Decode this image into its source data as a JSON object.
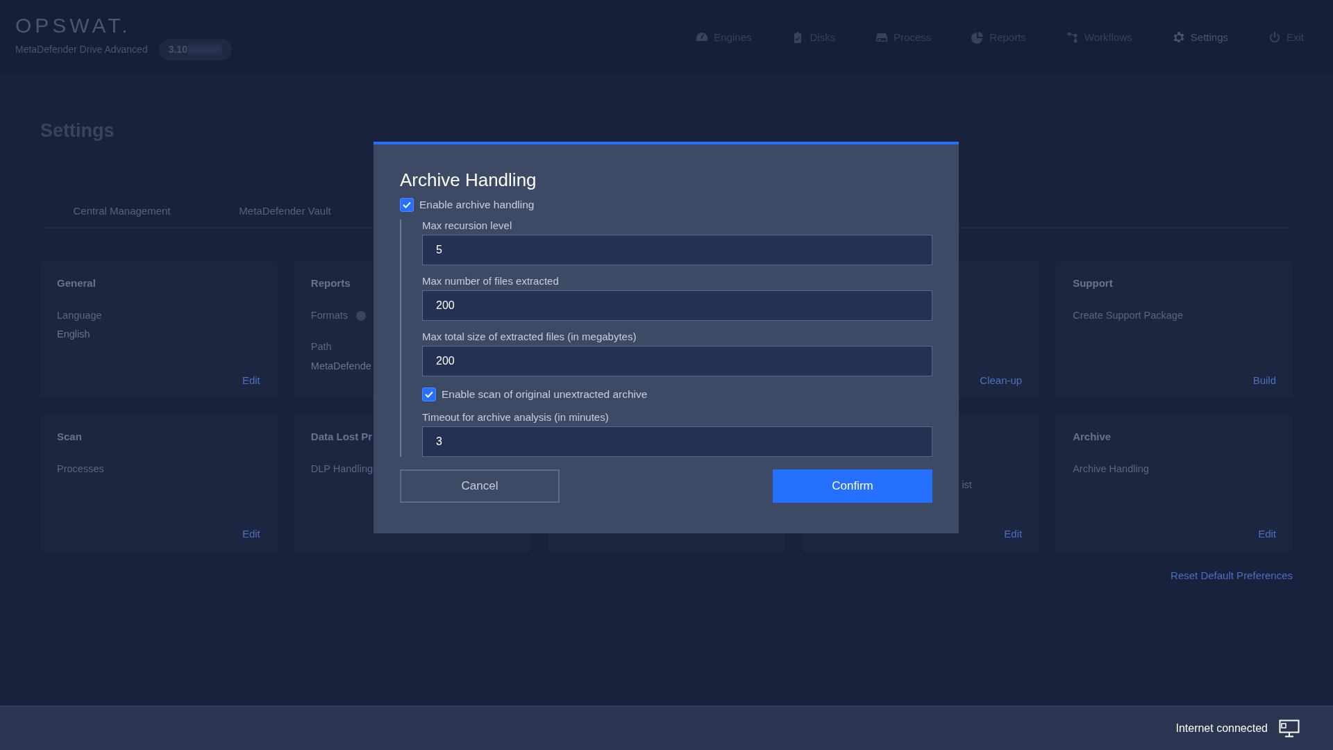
{
  "header": {
    "logo": "OPSWAT.",
    "product": "MetaDefender Drive Advanced",
    "version": "3.10"
  },
  "nav": [
    {
      "label": "Engines",
      "selected": false
    },
    {
      "label": "Disks",
      "selected": false
    },
    {
      "label": "Process",
      "selected": false
    },
    {
      "label": "Reports",
      "selected": false
    },
    {
      "label": "Workflows",
      "selected": false
    },
    {
      "label": "Settings",
      "selected": true
    },
    {
      "label": "Exit",
      "selected": false
    }
  ],
  "page": {
    "title": "Settings",
    "tabs": [
      {
        "label": "Central Management",
        "selected": false
      },
      {
        "label": "MetaDefender Vault",
        "selected": false
      }
    ]
  },
  "cards": [
    {
      "title": "General",
      "lines": [
        {
          "text": "Language",
          "kind": "label"
        },
        {
          "text": "English",
          "kind": "value"
        }
      ],
      "action": "Edit"
    },
    {
      "title": "Reports",
      "lines": [
        {
          "text": "Formats",
          "kind": "info"
        },
        {
          "text": "Path",
          "kind": "label"
        },
        {
          "text": "MetaDefende",
          "kind": "value"
        }
      ]
    },
    {
      "action": "Clean-up"
    },
    {
      "title": "Support",
      "lines": [
        {
          "text": "Create Support Package",
          "kind": "label"
        }
      ],
      "action": "Build"
    },
    {
      "title": "Scan",
      "lines": [
        {
          "text": "Processes",
          "kind": "label"
        }
      ],
      "action": "Edit"
    },
    {
      "title": "Data Lost Pr",
      "lines": [
        {
          "text": "DLP Handling",
          "kind": "label"
        }
      ]
    },
    {
      "lines": [
        {
          "text": "ist",
          "kind": "tail"
        }
      ],
      "action": "Edit"
    },
    {
      "title": "Archive",
      "lines": [
        {
          "text": "Archive Handling",
          "kind": "label"
        }
      ],
      "action": "Edit"
    }
  ],
  "reset_link": "Reset Default Preferences",
  "modal": {
    "title": "Archive Handling",
    "enable": {
      "label": "Enable archive handling",
      "checked": true
    },
    "fields": [
      {
        "kind": "input",
        "label": "Max recursion level",
        "value": "5"
      },
      {
        "kind": "input",
        "label": "Max number of files extracted",
        "value": "200"
      },
      {
        "kind": "input",
        "label": "Max total size of extracted files (in megabytes)",
        "value": "200"
      },
      {
        "kind": "checkbox",
        "label": "Enable scan of original unextracted archive",
        "checked": true
      },
      {
        "kind": "input",
        "label": "Timeout for archive analysis (in minutes)",
        "value": "3"
      }
    ],
    "buttons": [
      {
        "label": "Cancel",
        "kind": "secondary"
      },
      {
        "label": "Confirm",
        "kind": "primary"
      }
    ]
  },
  "status_bar": {
    "text": "Internet connected"
  }
}
